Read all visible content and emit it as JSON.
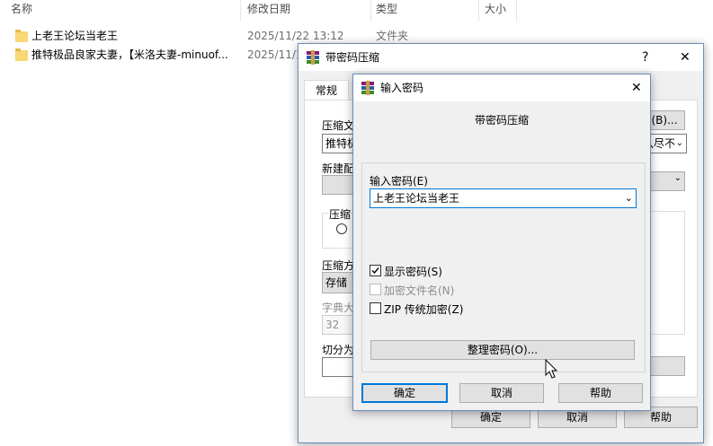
{
  "explorer": {
    "columns": {
      "name": "名称",
      "modified": "修改日期",
      "type": "类型",
      "size": "大小"
    },
    "rows": [
      {
        "name": "上老王论坛当老王",
        "modified": "2025/11/22 13:12",
        "type": "文件夹"
      },
      {
        "name": "推特极品良家夫妻，【米洛夫妻-minuof...",
        "modified": "2025/11/1"
      }
    ]
  },
  "back_dialog": {
    "title": "带密码压缩",
    "help_glyph": "?",
    "close_glyph": "✕",
    "tab_general": "常规",
    "label_archive": "压缩文",
    "archive_value": "推特极",
    "browse_label": "(B)...",
    "label_new_profile": "新建配",
    "update_value": "入尽不",
    "label_format": "压缩",
    "label_method": "压缩方",
    "method_value": "存储",
    "label_dict": "字典大",
    "dict_value": "32",
    "label_split": "切分为",
    "ok": "确定",
    "cancel": "取消",
    "help": "帮助"
  },
  "front_dialog": {
    "title": "输入密码",
    "close_glyph": "✕",
    "heading": "带密码压缩",
    "label_password": "输入密码(E)",
    "password_value": "上老王论坛当老王",
    "show_password": "显示密码(S)",
    "encrypt_filenames": "加密文件名(N)",
    "zip_legacy": "ZIP 传统加密(Z)",
    "organize_button": "整理密码(O)...",
    "ok": "确定",
    "cancel": "取消",
    "help": "帮助"
  }
}
